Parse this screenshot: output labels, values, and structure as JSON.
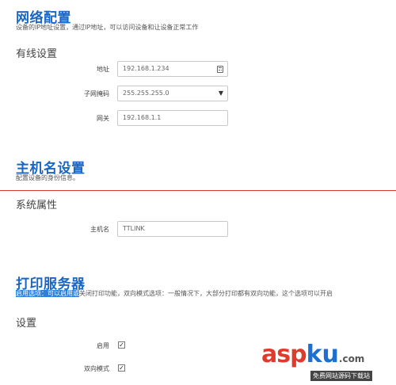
{
  "network": {
    "title": "网络配置",
    "description": "设备的IP地址设置，通过IP地址，可以访问设备和让设备正常工作",
    "wired_title": "有线设置",
    "address_label": "地址",
    "address_placeholder": "192.168.1.234",
    "subnet_label": "子网掩码",
    "subnet_value": "255.255.255.0",
    "gateway_label": "网关",
    "gateway_value": "192.168.1.1"
  },
  "hostname": {
    "title": "主机名设置",
    "description": "配置设备的身份信息。",
    "props_title": "系统属性",
    "host_label": "主机名",
    "host_value": "TTLINK"
  },
  "print": {
    "title": "打印服务器",
    "desc_highlight": "启用选项：可以启用或",
    "desc_rest": "关闭打印功能，双向模式选项：一般情况下，大部分打印都有双向功能，这个选项可以开启",
    "settings_title": "设置",
    "enable_label": "启用",
    "enable_checked": true,
    "bidir_label": "双向模式",
    "bidir_checked": true
  },
  "watermark": {
    "asp": "asp",
    "ku": "ku",
    "com": ".com",
    "sub": "免费网站源码下载站"
  },
  "colors": {
    "title_blue": "#1a66c4",
    "divider_red": "#d43a2f",
    "highlight_blue": "#2f7ed8"
  }
}
